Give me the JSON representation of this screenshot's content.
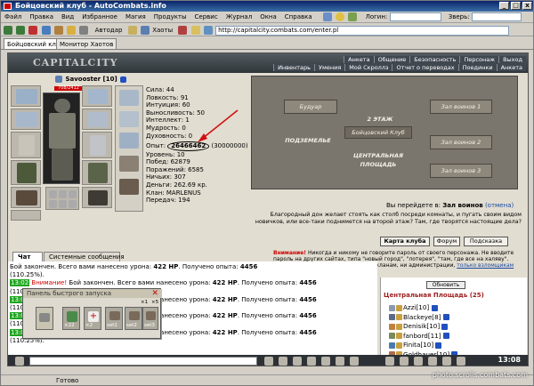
{
  "window": {
    "title": "Бойцовский клуб - AutoCombats.info"
  },
  "menu": {
    "items": [
      "Файл",
      "Правка",
      "Вид",
      "Избранное",
      "Магия",
      "Продукты",
      "Сервис",
      "Журнал",
      "Окна",
      "Справка"
    ],
    "login_label": "Логин:",
    "beast_label": "Зверь:"
  },
  "toolbar": {
    "autocast_label": "Автодар",
    "hauts_label": "Хаоты",
    "address": "http://capitalcity.combats.com/enter.pl"
  },
  "tabs": [
    {
      "label": "Бойцовский клуб"
    },
    {
      "label": "Монитор Хаотов"
    }
  ],
  "game": {
    "logo": "CAPITALCITY",
    "nav_top": [
      "Анкета",
      "Общение",
      "Безопасность",
      "Персонаж",
      "Выход"
    ],
    "nav_bottom": [
      "Инвентарь",
      "Умения",
      "Мой Скроллз",
      "Отчет о переводах",
      "Поединки",
      "Анкета"
    ],
    "character": {
      "name": "Savooster",
      "level": "[10]",
      "hp": "708/2412",
      "stats": [
        "Сила: 44",
        "Ловкость: 91",
        "Интуиция: 60",
        "Выносливость: 50",
        "Интеллект: 1",
        "Мудрость: 0",
        "Духовность: 0"
      ],
      "exp_label": "Опыт:",
      "exp_value": "26466462",
      "exp_next": "(30000000)",
      "info": [
        "Уровень: 10",
        "Побед: 62879",
        "Поражений: 6585",
        "Ничьих: 307",
        "Деньги: 262.69 кр.",
        "Клан: MARLENUS",
        "Передач: 194"
      ]
    },
    "map": {
      "rooms": [
        "Будуар",
        "Зал воинов 1",
        "2 ЭТАЖ",
        "Бойцовский Клуб",
        "ПОДЗЕМЕЛЬЕ",
        "Зал воинов 2",
        "ЦЕНТРАЛЬНАЯ ПЛОЩАДЬ",
        "Зал воинов 3"
      ]
    },
    "move_notice": "Вы перейдете в:",
    "move_target": "Зал воинов",
    "move_cancel": "(отмена)",
    "description": "Благородный дон желает стоять как столб посреди комнаты, и пугать своим видом новичков, или все-таки поднимется на второй этаж? Там, где творятся настоящие дела?",
    "buttons": [
      "Карта клуба",
      "Форум",
      "Подсказка"
    ],
    "warning_bold": "Внимание!",
    "warning_text": "Никогда и никому не говорите пароль от своего персонажа. Не вводите пароль на других сайтах, типа \"новый город\", \"лотерея\", \"там, где все на халяву\". Пароль не нужен ни паладинам, ни кланам, ни администрации,",
    "warning_link": "только взломщикам",
    "quick_panel": {
      "title": "Панель быстрого запуска",
      "close": "✕",
      "slots": [
        "",
        "×22",
        "×2",
        "×1",
        "×5"
      ],
      "sets": [
        "set1",
        "set2",
        "set3"
      ]
    },
    "chat": {
      "tabs": [
        "Чат",
        "Системные сообщения"
      ],
      "lines": [
        {
          "ts": "",
          "red": "",
          "text": "Бой закончен. Всего вами нанесено урона:",
          "hp": "422 HP",
          "got": "Получено опыта:",
          "exp": "4456"
        },
        {
          "ts": "",
          "red": "",
          "text": "(110.25%).",
          "hp": "",
          "got": "",
          "exp": ""
        },
        {
          "ts": "13:02",
          "red": "Внимание!",
          "text": "Бой закончен. Всего вами нанесено урона:",
          "hp": "422 HP",
          "got": "Получено опыта:",
          "exp": "4456"
        },
        {
          "ts": "",
          "red": "",
          "text": "(110.25%).",
          "hp": "",
          "got": "",
          "exp": ""
        },
        {
          "ts": "13:02",
          "red": "Внимание!",
          "text": "Бой закончен. Всего вами нанесено урона:",
          "hp": "422 HP",
          "got": "Получено опыта:",
          "exp": "4456"
        },
        {
          "ts": "",
          "red": "",
          "text": "(110.25%).",
          "hp": "",
          "got": "",
          "exp": ""
        },
        {
          "ts": "13:02",
          "red": "Внимание!",
          "text": "Бой закончен. Всего вами нанесено урона:",
          "hp": "422 HP",
          "got": "Получено опыта:",
          "exp": "4456"
        },
        {
          "ts": "",
          "red": "",
          "text": "(110.25%).",
          "hp": "",
          "got": "",
          "exp": ""
        },
        {
          "ts": "13:02",
          "red": "Внимание!",
          "text": "Бой закончен. Всего вами нанесено урона:",
          "hp": "422 HP",
          "got": "Получено опыта:",
          "exp": "4456"
        },
        {
          "ts": "",
          "red": "",
          "text": "(110.25%).",
          "hp": "",
          "got": "",
          "exp": ""
        }
      ]
    },
    "online": {
      "refresh": "Обновить",
      "location": "Центральная Площадь (25)",
      "players": [
        {
          "name": "Azzi",
          "level": "[10]"
        },
        {
          "name": "Blackeye",
          "level": "[8]"
        },
        {
          "name": "Denisik",
          "level": "[10]"
        },
        {
          "name": "fanbord",
          "level": "[11]"
        },
        {
          "name": "Finita",
          "level": "[10]"
        },
        {
          "name": "Goldhauer",
          "level": "[10]"
        }
      ]
    },
    "clock": "13:08"
  },
  "status": {
    "text": "Готово"
  },
  "watermark": "photo.scrolls.combats.com",
  "colors": {
    "title_bar": "#0a246a",
    "timestamp_bg": "#1fa61f",
    "warning_red": "#c00000",
    "location_title": "#9b1c1c",
    "hp_bar": "#cc0000"
  }
}
